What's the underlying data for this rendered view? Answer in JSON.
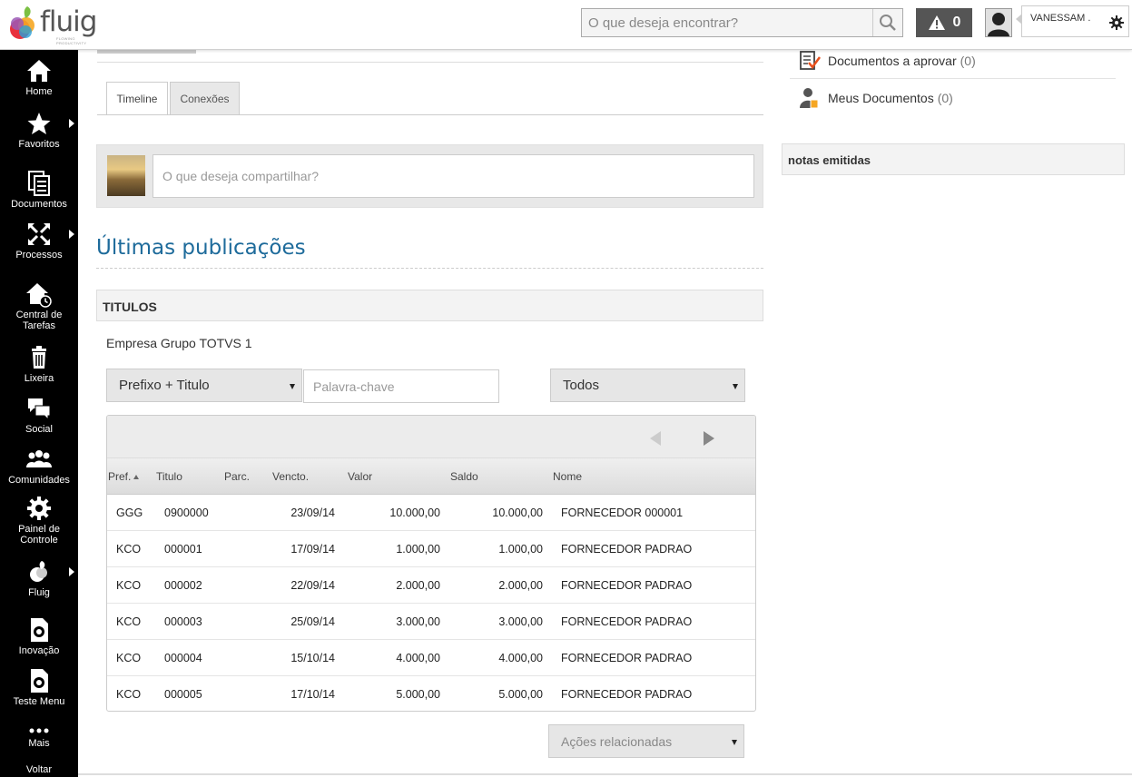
{
  "app": {
    "logo_text": "fluig",
    "logo_sub": "FLOWING PRODUCTIVITY",
    "search_placeholder": "O que deseja encontrar?",
    "alerts_count": "0",
    "user_name": "VANESSAM .",
    "brand_colors": [
      "#e8313d",
      "#f5a623",
      "#7bc043",
      "#2a9fd8",
      "#9b59b6"
    ]
  },
  "sidebar": {
    "items": [
      {
        "label": "Home",
        "icon": "home-icon"
      },
      {
        "label": "Favoritos",
        "icon": "star-icon"
      },
      {
        "label": "Documentos",
        "icon": "documents-icon"
      },
      {
        "label": "Processos",
        "icon": "processes-icon"
      },
      {
        "label": "Central de Tarefas",
        "icon": "task-center-icon"
      },
      {
        "label": "Lixeira",
        "icon": "trash-icon"
      },
      {
        "label": "Social",
        "icon": "chat-icon"
      },
      {
        "label": "Comunidades",
        "icon": "communities-icon"
      },
      {
        "label": "Painel de Controle",
        "icon": "gear-icon"
      },
      {
        "label": "Fluig",
        "icon": "fluig-icon"
      },
      {
        "label": "Inovação",
        "icon": "innovation-icon"
      },
      {
        "label": "Teste Menu",
        "icon": "test-menu-icon"
      },
      {
        "label": "Mais",
        "icon": "more-icon"
      },
      {
        "label": "Voltar",
        "icon": "back-icon"
      }
    ]
  },
  "tabs": [
    {
      "label": "Timeline"
    },
    {
      "label": "Conexões"
    }
  ],
  "share": {
    "placeholder": "O que deseja compartilhar?"
  },
  "section_title": "Últimas publicações",
  "titulos": {
    "header": "TITULOS",
    "empresa": "Empresa Grupo TOTVS 1",
    "filter_field": "Prefixo + Titulo",
    "keyword_placeholder": "Palavra-chave",
    "filter_status": "Todos",
    "columns": [
      "Pref.",
      "Titulo",
      "Parc.",
      "Vencto.",
      "Valor",
      "Saldo",
      "Nome"
    ],
    "rows": [
      {
        "pref": "GGG",
        "titulo": "0900000",
        "parc": "",
        "vencto": "23/09/14",
        "valor": "10.000,00",
        "saldo": "10.000,00",
        "nome": "FORNECEDOR 000001"
      },
      {
        "pref": "KCO",
        "titulo": "000001",
        "parc": "",
        "vencto": "17/09/14",
        "valor": "1.000,00",
        "saldo": "1.000,00",
        "nome": "FORNECEDOR PADRAO"
      },
      {
        "pref": "KCO",
        "titulo": "000002",
        "parc": "",
        "vencto": "22/09/14",
        "valor": "2.000,00",
        "saldo": "2.000,00",
        "nome": "FORNECEDOR PADRAO"
      },
      {
        "pref": "KCO",
        "titulo": "000003",
        "parc": "",
        "vencto": "25/09/14",
        "valor": "3.000,00",
        "saldo": "3.000,00",
        "nome": "FORNECEDOR PADRAO"
      },
      {
        "pref": "KCO",
        "titulo": "000004",
        "parc": "",
        "vencto": "15/10/14",
        "valor": "4.000,00",
        "saldo": "4.000,00",
        "nome": "FORNECEDOR PADRAO"
      },
      {
        "pref": "KCO",
        "titulo": "000005",
        "parc": "",
        "vencto": "17/10/14",
        "valor": "5.000,00",
        "saldo": "5.000,00",
        "nome": "FORNECEDOR PADRAO"
      }
    ],
    "actions_label": "Ações relacionadas"
  },
  "right": {
    "docs_approve": {
      "label": "Documentos a aprovar",
      "count": "(0)"
    },
    "my_docs": {
      "label": "Meus Documentos",
      "count": "(0)"
    },
    "notas_header": "notas emitidas"
  }
}
